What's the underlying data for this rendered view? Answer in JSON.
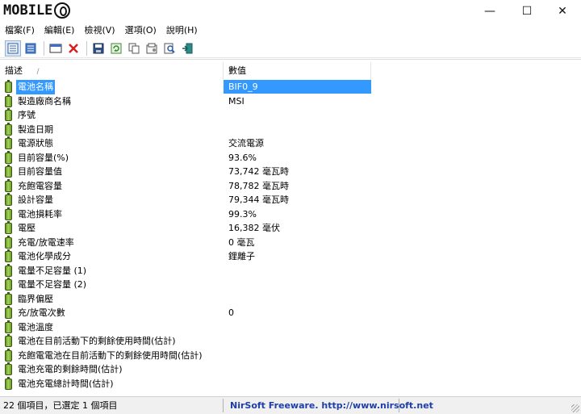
{
  "window": {
    "logo_text": "MOBILE",
    "minimize": "—",
    "maximize": "☐",
    "close": "✕"
  },
  "menu": [
    "檔案(F)",
    "編輯(E)",
    "檢視(V)",
    "選項(O)",
    "說明(H)"
  ],
  "columns": {
    "description": "描述",
    "sort_indicator": "/",
    "value": "數值"
  },
  "rows": [
    {
      "desc": "電池名稱",
      "val": "BIF0_9",
      "selected": true
    },
    {
      "desc": "製造廠商名稱",
      "val": "MSI"
    },
    {
      "desc": "序號",
      "val": ""
    },
    {
      "desc": "製造日期",
      "val": ""
    },
    {
      "desc": "電源狀態",
      "val": "交流電源"
    },
    {
      "desc": "目前容量(%)",
      "val": "93.6%"
    },
    {
      "desc": "目前容量值",
      "val": "73,742 毫瓦時"
    },
    {
      "desc": "充飽電容量",
      "val": "78,782 毫瓦時"
    },
    {
      "desc": "設計容量",
      "val": "79,344 毫瓦時"
    },
    {
      "desc": "電池損耗率",
      "val": "99.3%"
    },
    {
      "desc": "電壓",
      "val": "16,382 毫伏"
    },
    {
      "desc": "充電/放電速率",
      "val": "0 毫瓦"
    },
    {
      "desc": "電池化學成分",
      "val": "鋰離子"
    },
    {
      "desc": "電量不足容量 (1)",
      "val": ""
    },
    {
      "desc": "電量不足容量 (2)",
      "val": ""
    },
    {
      "desc": "臨界偏壓",
      "val": ""
    },
    {
      "desc": "充/放電次數",
      "val": "0"
    },
    {
      "desc": "電池溫度",
      "val": ""
    },
    {
      "desc": "電池在目前活動下的剩餘使用時間(估計)",
      "val": ""
    },
    {
      "desc": "充飽電電池在目前活動下的剩餘使用時間(估計)",
      "val": ""
    },
    {
      "desc": "電池充電的剩餘時間(估計)",
      "val": ""
    },
    {
      "desc": "電池充電總計時間(估計)",
      "val": ""
    }
  ],
  "status": {
    "items": "22 個項目，已選定 1 個項目",
    "credit": "NirSoft Freeware.  http://www.nirsoft.net"
  },
  "colors": {
    "selection": "#3399ff",
    "link": "#1f3fa8",
    "battery": "#7cb342"
  }
}
